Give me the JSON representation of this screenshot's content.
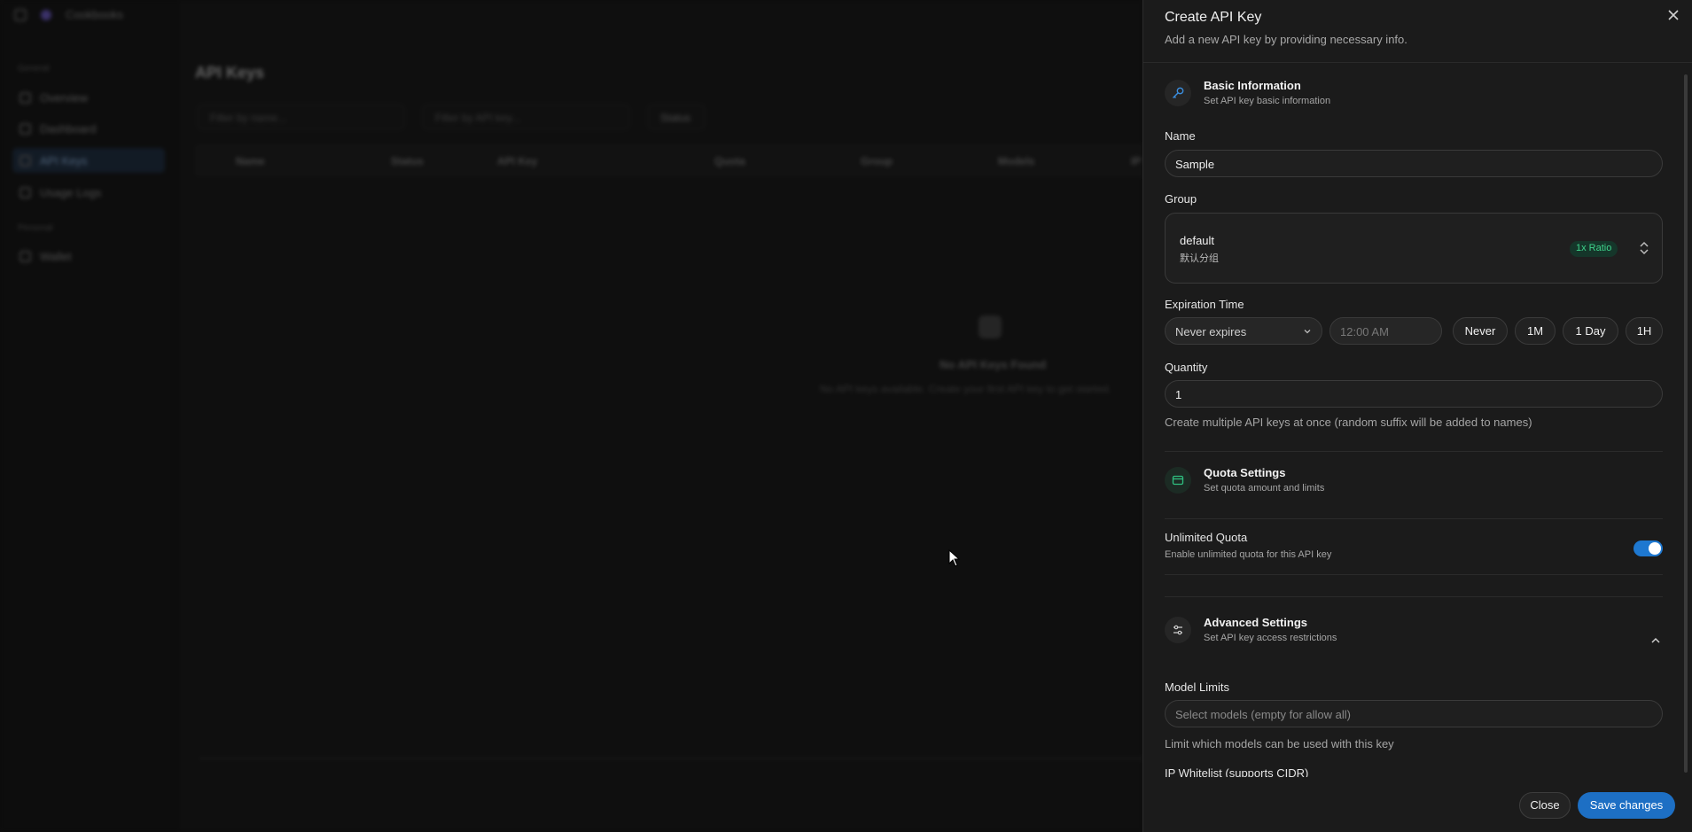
{
  "background": {
    "brand": "Cookbooks",
    "sections": [
      "General",
      "Personal"
    ],
    "nav": [
      "Overview",
      "Dashboard",
      "API Keys",
      "Usage Logs",
      "Wallet"
    ],
    "page_title": "API Keys",
    "filters": [
      "Filter by name...",
      "Filter by API key...",
      "Status"
    ],
    "columns": [
      "Name",
      "Status",
      "API Key",
      "Quota",
      "Group",
      "Models",
      "IP"
    ],
    "empty_title": "No API Keys Found",
    "empty_desc": "No API keys available. Create your first API key to get started."
  },
  "panel": {
    "title": "Create API Key",
    "description": "Add a new API key by providing necessary info.",
    "basic": {
      "title": "Basic Information",
      "subtitle": "Set API key basic information",
      "name_label": "Name",
      "name_value": "Sample",
      "group_label": "Group",
      "group_name": "default",
      "group_desc": "默认分组",
      "group_ratio": "1x Ratio",
      "expiration_label": "Expiration Time",
      "expiration_select": "Never expires",
      "time_placeholder": "12:00 AM",
      "presets": [
        "Never",
        "1M",
        "1 Day",
        "1H"
      ],
      "quantity_label": "Quantity",
      "quantity_value": "1",
      "quantity_help": "Create multiple API keys at once (random suffix will be added to names)"
    },
    "quota": {
      "title": "Quota Settings",
      "subtitle": "Set quota amount and limits",
      "unlimited_label": "Unlimited Quota",
      "unlimited_desc": "Enable unlimited quota for this API key",
      "unlimited_on": true
    },
    "advanced": {
      "title": "Advanced Settings",
      "subtitle": "Set API key access restrictions",
      "model_limits_label": "Model Limits",
      "model_limits_placeholder": "Select models (empty for allow all)",
      "model_limits_help": "Limit which models can be used with this key",
      "ip_label": "IP Whitelist (supports CIDR)"
    },
    "footer": {
      "close": "Close",
      "save": "Save changes"
    }
  },
  "colors": {
    "accent": "#1d6fc4",
    "ratio_green": "#3fd38c",
    "icon_blue": "#3b8fe0",
    "icon_green": "#2fbf7f"
  }
}
